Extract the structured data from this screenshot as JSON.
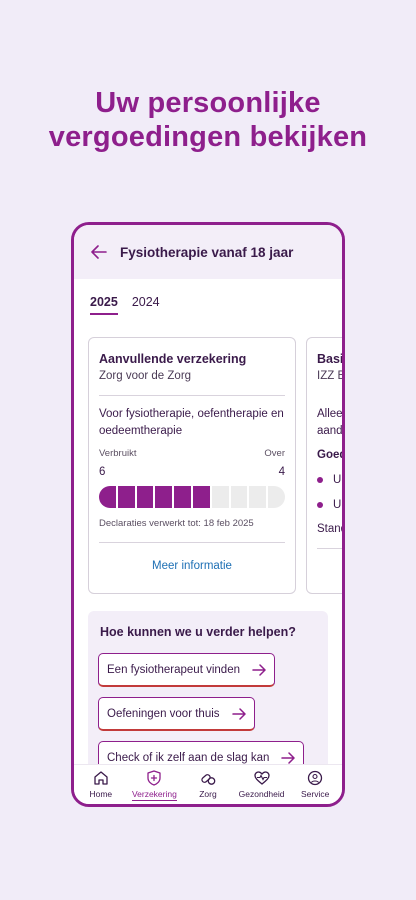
{
  "headline": {
    "line1": "Uw persoonlijke",
    "line2": "vergoedingen bekijken"
  },
  "appbar": {
    "title": "Fysiotherapie vanaf 18 jaar",
    "back_icon": "arrow-left-icon"
  },
  "tabs": [
    {
      "label": "2025",
      "active": true
    },
    {
      "label": "2024",
      "active": false
    }
  ],
  "card": {
    "title": "Aanvullende verzekering",
    "subtitle": "Zorg voor de Zorg",
    "description": "Voor fysiotherapie, oefentherapie en oedeemtherapie",
    "used_label": "Verbruikt",
    "remaining_label": "Over",
    "used_value": "6",
    "remaining_value": "4",
    "used_sessions": 6,
    "total_sessions": 10,
    "processed_text": "Declaraties verwerkt tot: 18 feb 2025",
    "more_link": "Meer informatie"
  },
  "peek_card": {
    "title": "Basi",
    "subtitle": "IZZ B",
    "line1": "Allee",
    "line2": "aand",
    "bold_line": "Goed",
    "bullet1": "U",
    "bullet2": "U",
    "line3": "Stand"
  },
  "help": {
    "title": "Hoe kunnen we u verder helpen?",
    "buttons": [
      {
        "label": "Een fysiotherapeut vinden"
      },
      {
        "label": "Oefeningen voor thuis"
      },
      {
        "label": "Check of ik zelf aan de slag kan"
      }
    ]
  },
  "navbar": {
    "items": [
      {
        "label": "Home",
        "icon": "home-icon",
        "active": false
      },
      {
        "label": "Verzekering",
        "icon": "shield-plus-icon",
        "active": true
      },
      {
        "label": "Zorg",
        "icon": "pills-icon",
        "active": false
      },
      {
        "label": "Gezondheid",
        "icon": "heart-pulse-icon",
        "active": false
      },
      {
        "label": "Service",
        "icon": "chat-support-icon",
        "active": false
      }
    ]
  },
  "colors": {
    "brand": "#8e1f8c",
    "link": "#1d6fb4",
    "background": "#f1ecf8"
  }
}
